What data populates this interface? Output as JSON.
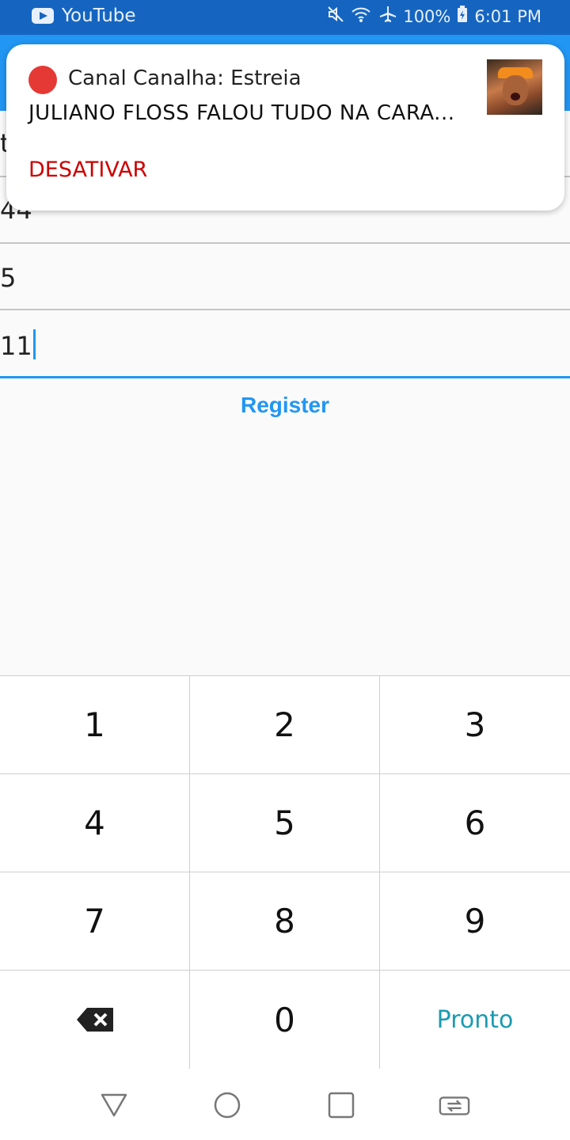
{
  "status_bar": {
    "app_name": "YouTube",
    "battery": "100%",
    "time": "6:01 PM",
    "icons": [
      "youtube-icon",
      "mute-icon",
      "wifi-icon",
      "airplane-icon",
      "battery-icon"
    ]
  },
  "fields": {
    "field_1_partial": "t",
    "field_2_partial": "44",
    "field_3": "5",
    "field_4": "11"
  },
  "register_label": "Register",
  "notification": {
    "title": "Canal Canalha: Estreia",
    "body": "JULIANO FLOSS FALOU TUDO NA CARA...",
    "action": "DESATIVAR",
    "colors": {
      "dot": "#e53935",
      "action": "#cc0000"
    }
  },
  "keypad": {
    "keys": [
      "1",
      "2",
      "3",
      "4",
      "5",
      "6",
      "7",
      "8",
      "9"
    ],
    "zero": "0",
    "done": "Pronto",
    "backspace_icon": "backspace-icon"
  },
  "nav_icons": [
    "back-icon",
    "home-icon",
    "recents-icon",
    "switch-app-icon"
  ],
  "colors": {
    "accent": "#2196f3",
    "status_bar": "#1565c0",
    "done": "#1a9bb0"
  }
}
